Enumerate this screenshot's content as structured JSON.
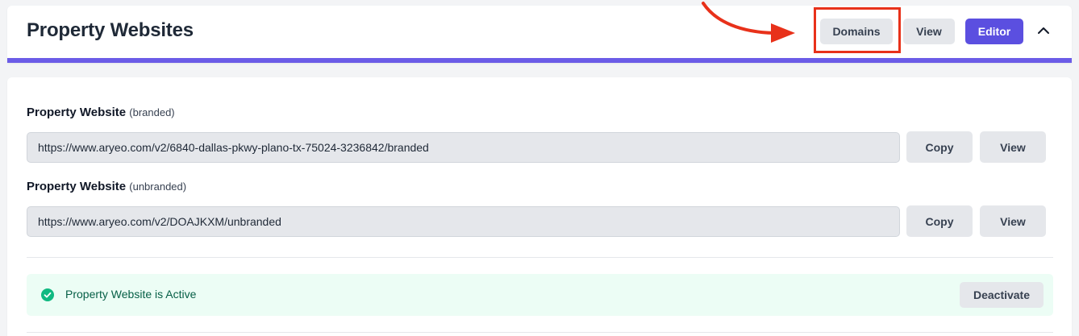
{
  "header": {
    "title": "Property Websites",
    "buttons": {
      "domains": "Domains",
      "view": "View",
      "editor": "Editor"
    },
    "accent_color": "#6b5ce7",
    "annotation_color": "#e8311a"
  },
  "websites": [
    {
      "label": "Property Website",
      "qualifier": "(branded)",
      "url": "https://www.aryeo.com/v2/6840-dallas-pkwy-plano-tx-75024-3236842/branded",
      "copy_label": "Copy",
      "view_label": "View"
    },
    {
      "label": "Property Website",
      "qualifier": "(unbranded)",
      "url": "https://www.aryeo.com/v2/DOAJKXM/unbranded",
      "copy_label": "Copy",
      "view_label": "View"
    }
  ],
  "status": {
    "text": "Property Website is Active",
    "action_label": "Deactivate",
    "color": "#10b981"
  }
}
